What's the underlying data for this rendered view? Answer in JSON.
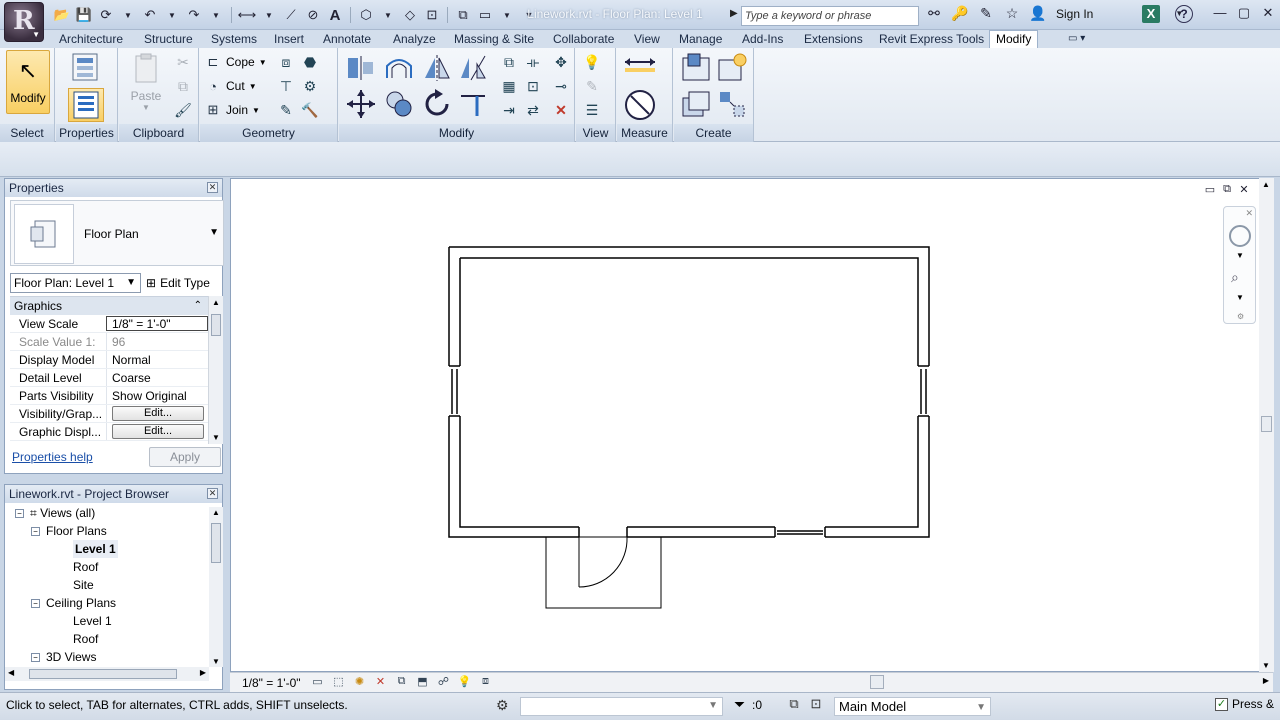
{
  "app": {
    "doc_title": "Linework.rvt - Floor Plan: Level 1",
    "search_placeholder": "Type a keyword or phrase",
    "sign_in": "Sign In",
    "help": "?"
  },
  "tabs": [
    "Architecture",
    "Structure",
    "Systems",
    "Insert",
    "Annotate",
    "Analyze",
    "Massing & Site",
    "Collaborate",
    "View",
    "Manage",
    "Add-Ins",
    "Extensions",
    "Revit Express Tools",
    "Modify"
  ],
  "active_tab": "Modify",
  "ribbon": {
    "select": {
      "modify_label": "Modify",
      "panel": "Select"
    },
    "properties": {
      "panel": "Properties"
    },
    "clipboard": {
      "paste_label": "Paste",
      "panel": "Clipboard"
    },
    "geometry": {
      "cope": "Cope",
      "cut": "Cut",
      "join": "Join",
      "panel": "Geometry"
    },
    "modify": {
      "panel": "Modify"
    },
    "view": {
      "panel": "View"
    },
    "measure": {
      "panel": "Measure"
    },
    "create": {
      "panel": "Create"
    }
  },
  "properties": {
    "title": "Properties",
    "type_name": "Floor Plan",
    "instance_filter": "Floor Plan: Level 1",
    "edit_type": "Edit Type",
    "category": "Graphics",
    "rows": [
      {
        "name": "View Scale",
        "value": "1/8\" = 1'-0\""
      },
      {
        "name": "Scale Value    1:",
        "value": "96"
      },
      {
        "name": "Display Model",
        "value": "Normal"
      },
      {
        "name": "Detail Level",
        "value": "Coarse"
      },
      {
        "name": "Parts Visibility",
        "value": "Show Original"
      },
      {
        "name": "Visibility/Grap...",
        "value": "Edit..."
      },
      {
        "name": "Graphic Displ...",
        "value": "Edit..."
      }
    ],
    "help": "Properties help",
    "apply": "Apply"
  },
  "browser": {
    "title": "Linework.rvt - Project Browser",
    "items": [
      {
        "label": "Views (all)",
        "level": 0,
        "toggle": "−"
      },
      {
        "label": "Floor Plans",
        "level": 1,
        "toggle": "−"
      },
      {
        "label": "Level 1",
        "level": 2,
        "bold": true
      },
      {
        "label": "Roof",
        "level": 2
      },
      {
        "label": "Site",
        "level": 2
      },
      {
        "label": "Ceiling Plans",
        "level": 1,
        "toggle": "−"
      },
      {
        "label": "Level 1",
        "level": 2
      },
      {
        "label": "Roof",
        "level": 2
      },
      {
        "label": "3D Views",
        "level": 1,
        "toggle": "−"
      }
    ]
  },
  "view": {
    "scale": "1/8\" = 1'-0\""
  },
  "status": {
    "message": "Click to select, TAB for alternates, CTRL adds, SHIFT unselects.",
    "selection_count": ":0",
    "model": "Main Model",
    "press_drag": "Press &",
    "press_drag_checked": true
  }
}
